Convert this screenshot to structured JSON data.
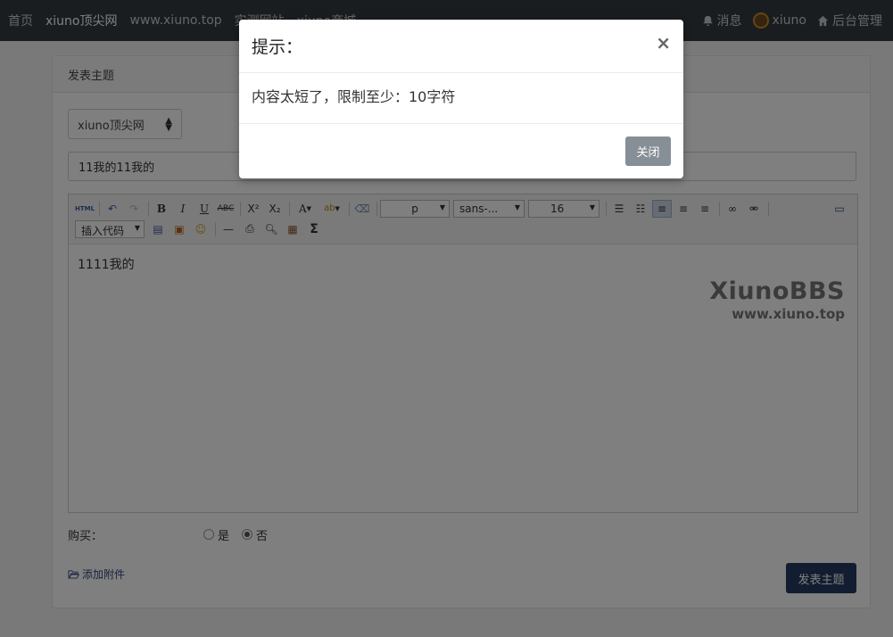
{
  "nav": {
    "left": [
      "首页",
      "xiuno顶尖网",
      "www.xiuno.top",
      "实测网站",
      "xiuno商城"
    ],
    "messages": "消息",
    "user": "xiuno",
    "admin": "后台管理"
  },
  "card": {
    "header": "发表主题",
    "forum_select": "xiuno顶尖网",
    "subject_value": "11我的11我的",
    "content": "1111我的",
    "watermark_line1": "XiunoBBS",
    "watermark_line2": "www.xiuno.top",
    "toolbar": {
      "format_select": "p",
      "font_select": "sans-...",
      "size_select": "16",
      "insert_code_select": "插入代码"
    },
    "buy_label": "购买：",
    "buy_yes": "是",
    "buy_no": "否",
    "attach": "添加附件",
    "submit": "发表主题"
  },
  "modal": {
    "title": "提示：",
    "close_symbol": "×",
    "message": "内容太短了，限制至少：10字符",
    "close_button": "关闭"
  },
  "colors": {
    "navbar": "#343a40",
    "submit": "#243b63",
    "close_button": "#868e96"
  }
}
